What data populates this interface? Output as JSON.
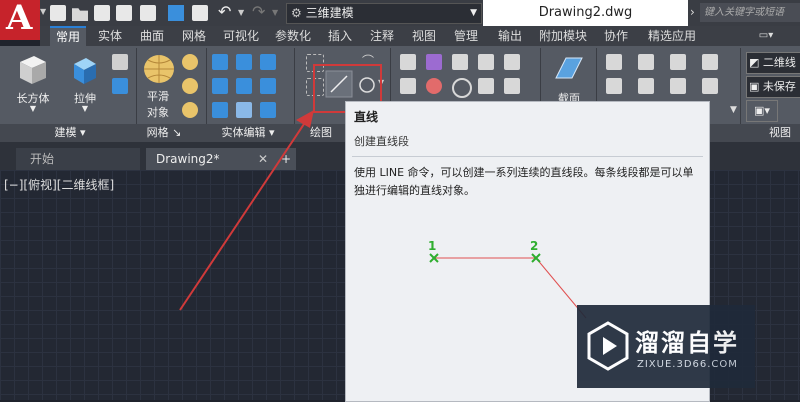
{
  "app": {
    "workspace": "三维建模",
    "document_title": "Drawing2.dwg",
    "search_placeholder": "键入关键字或短语"
  },
  "ribbon_tabs": [
    "常用",
    "实体",
    "曲面",
    "网格",
    "可视化",
    "参数化",
    "插入",
    "注释",
    "视图",
    "管理",
    "输出",
    "附加模块",
    "协作",
    "精选应用"
  ],
  "ribbon": {
    "buttons": {
      "box": "长方体",
      "extrude": "拉伸",
      "smooth_object_line1": "平滑",
      "smooth_object_line2": "对象",
      "section_plane": "截面"
    },
    "panels": {
      "modeling": "建模",
      "mesh": "网格",
      "solid_edit": "实体编辑",
      "draw": "绘图",
      "view": "视图"
    },
    "right_items": [
      "二维线",
      "未保存"
    ]
  },
  "doc_tabs": {
    "start": "开始",
    "drawing": "Drawing2*"
  },
  "viewport_label": "[−][俯视][二维线框]",
  "tooltip": {
    "title": "直线",
    "subtitle": "创建直线段",
    "description": "使用 LINE 命令，可以创建一系列连续的直线段。每条线段都是可以单独进行编辑的直线对象。",
    "point1": "1",
    "point2": "2"
  },
  "watermark": {
    "name": "溜溜自学",
    "url": "ZIXUE.3D66.COM"
  },
  "colors": {
    "highlight": "#d03a3a",
    "accent_blue": "#2a7fd5",
    "point_green": "#2fae2f",
    "logo_red": "#c6232b"
  }
}
